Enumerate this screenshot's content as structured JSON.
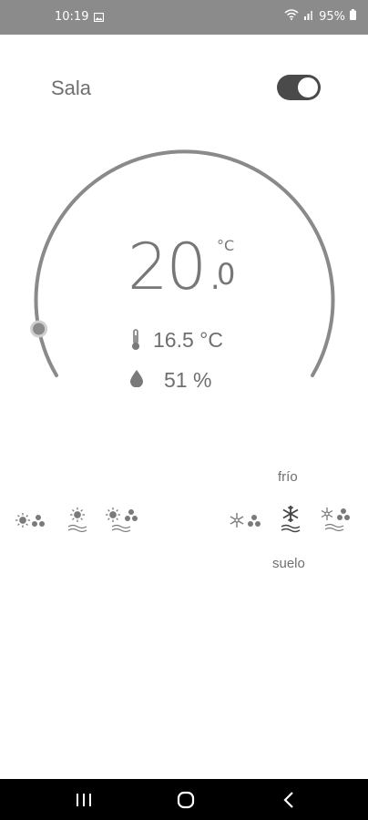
{
  "status_bar": {
    "time": "10:19",
    "battery": "95%",
    "icons": [
      "image-icon",
      "wifi-icon",
      "signal-icon",
      "battery-icon"
    ]
  },
  "room": {
    "name": "Sala",
    "power_on": true
  },
  "thermostat": {
    "setpoint_integer": "20.",
    "setpoint_decimal": "0",
    "setpoint_unit": "°C",
    "current_temperature": "16.5 °C",
    "humidity": "51 %",
    "dial_level": 0.08
  },
  "modes": {
    "label_cold": "frío",
    "label_floor": "suelo",
    "heating_icons": [
      "sun-fan-icon",
      "sun-floor-icon",
      "sun-floor-fan-icon"
    ],
    "cooling_icons": [
      "snowflake-fan-icon",
      "snowflake-floor-icon",
      "snowflake-floor-fan-icon"
    ]
  },
  "colors": {
    "status_bar": "#8b8b8b",
    "accent": "#8a8a8a",
    "text": "#777777"
  },
  "nav_bar": {
    "icons": [
      "recents-icon",
      "home-icon",
      "back-icon"
    ]
  }
}
